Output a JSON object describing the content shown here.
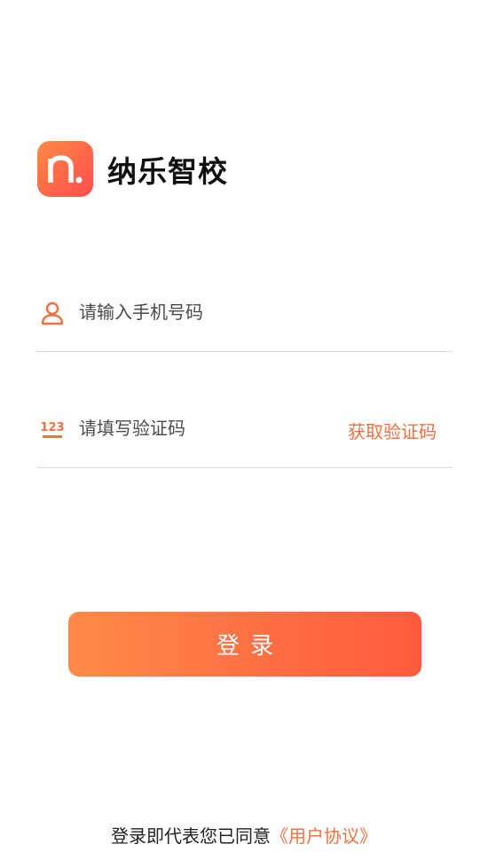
{
  "brand": {
    "logo_letter": "n.",
    "app_name": "纳乐智校"
  },
  "phone": {
    "icon": "user-icon",
    "placeholder": "请输入手机号码",
    "value": ""
  },
  "code": {
    "icon": "number-123-icon",
    "icon_text": "123",
    "placeholder": "请填写验证码",
    "value": "",
    "get_code_label": "获取验证码"
  },
  "login": {
    "label": "登录"
  },
  "agreement": {
    "prefix": "登录即代表您已同意",
    "link": "《用户协议》"
  },
  "colors": {
    "accent": "#f27140",
    "button_start": "#ff8a48",
    "button_end": "#ff5a3e",
    "logo_start": "#ff8a45",
    "logo_end": "#ff4d4d"
  }
}
